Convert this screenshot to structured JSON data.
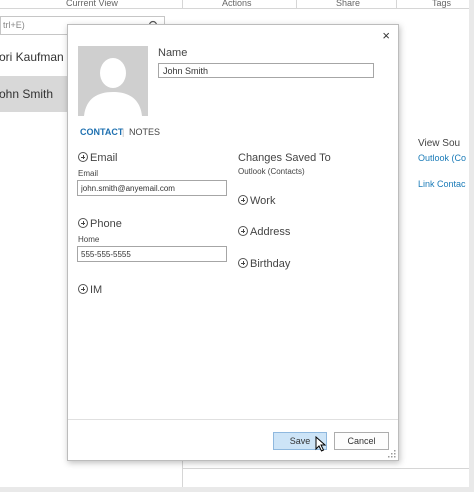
{
  "ribbon": {
    "groups": [
      "Current View",
      "Actions",
      "Share",
      "Tags"
    ]
  },
  "search": {
    "hint": "trl+E)"
  },
  "contact_list": [
    {
      "name": "ori Kaufman"
    },
    {
      "name": "ohn Smith"
    }
  ],
  "right_pane": {
    "title": "View Sou",
    "link1": "Outlook (Co",
    "link2": "Link Contac"
  },
  "dialog": {
    "name_label": "Name",
    "name_value": "John Smith",
    "tabs": {
      "contact": "CONTACT",
      "separator": "|",
      "notes": "NOTES"
    },
    "email": {
      "header": "Email",
      "label": "Email",
      "value": "john.smith@anyemail.com"
    },
    "phone": {
      "header": "Phone",
      "label": "Home",
      "value": "555-555-5555"
    },
    "im": {
      "header": "IM"
    },
    "changes_saved": {
      "title": "Changes Saved To",
      "location": "Outlook (Contacts)"
    },
    "add_sections": {
      "work": "Work",
      "address": "Address",
      "birthday": "Birthday"
    },
    "buttons": {
      "save": "Save",
      "cancel": "Cancel"
    },
    "close_glyph": "×"
  },
  "colors": {
    "accent": "#1e70b0",
    "save_button": "#cde4f7",
    "list_selected": "#d8d8d8"
  }
}
